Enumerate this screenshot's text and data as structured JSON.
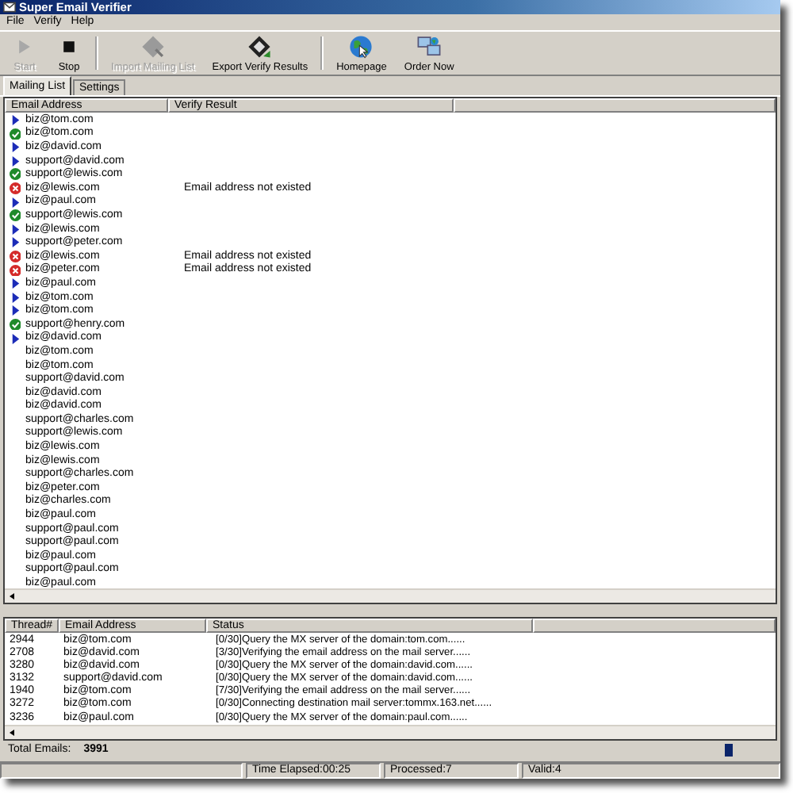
{
  "window": {
    "title": "Super Email Verifier"
  },
  "menu": [
    "File",
    "Verify",
    "Help"
  ],
  "toolbar": [
    {
      "label": "Start",
      "kind": "play",
      "disabled": true
    },
    {
      "label": "Stop",
      "kind": "stop",
      "disabled": false
    },
    {
      "label": "Import Mailing List",
      "kind": "import",
      "disabled": true
    },
    {
      "label": "Export Verify Results",
      "kind": "export",
      "disabled": false
    },
    {
      "label": "Homepage",
      "kind": "globe",
      "disabled": false
    },
    {
      "label": "Order Now",
      "kind": "order",
      "disabled": false
    }
  ],
  "tabs": [
    {
      "label": "Mailing List",
      "selected": true
    },
    {
      "label": "Settings",
      "selected": false
    }
  ],
  "mailing_list": {
    "columns": [
      "Email Address",
      "Verify Result"
    ],
    "rows": [
      {
        "email": "biz@tom.com",
        "kind": "pending"
      },
      {
        "email": "biz@tom.com",
        "kind": "valid"
      },
      {
        "email": "biz@david.com",
        "kind": "pending"
      },
      {
        "email": "support@david.com",
        "kind": "pending"
      },
      {
        "email": "support@lewis.com",
        "kind": "valid"
      },
      {
        "email": "biz@lewis.com",
        "kind": "invalid",
        "result": "Email address not existed"
      },
      {
        "email": "biz@paul.com",
        "kind": "pending"
      },
      {
        "email": "support@lewis.com",
        "kind": "valid"
      },
      {
        "email": "biz@lewis.com",
        "kind": "pending"
      },
      {
        "email": "support@peter.com",
        "kind": "pending"
      },
      {
        "email": "biz@lewis.com",
        "kind": "invalid",
        "result": "Email address not existed"
      },
      {
        "email": "biz@peter.com",
        "kind": "invalid",
        "result": "Email address not existed"
      },
      {
        "email": "biz@paul.com",
        "kind": "pending"
      },
      {
        "email": "biz@tom.com",
        "kind": "pending"
      },
      {
        "email": "biz@tom.com",
        "kind": "pending"
      },
      {
        "email": "support@henry.com",
        "kind": "valid"
      },
      {
        "email": "biz@david.com",
        "kind": "pending"
      },
      {
        "email": "biz@tom.com",
        "kind": "queued"
      },
      {
        "email": "biz@tom.com",
        "kind": "queued"
      },
      {
        "email": "support@david.com",
        "kind": "queued"
      },
      {
        "email": "biz@david.com",
        "kind": "queued"
      },
      {
        "email": "biz@david.com",
        "kind": "queued"
      },
      {
        "email": "support@charles.com",
        "kind": "queued"
      },
      {
        "email": "support@lewis.com",
        "kind": "queued"
      },
      {
        "email": "biz@lewis.com",
        "kind": "queued"
      },
      {
        "email": "biz@lewis.com",
        "kind": "queued"
      },
      {
        "email": "support@charles.com",
        "kind": "queued"
      },
      {
        "email": "biz@peter.com",
        "kind": "queued"
      },
      {
        "email": "biz@charles.com",
        "kind": "queued"
      },
      {
        "email": "biz@paul.com",
        "kind": "queued"
      },
      {
        "email": "support@paul.com",
        "kind": "queued"
      },
      {
        "email": "support@paul.com",
        "kind": "queued"
      },
      {
        "email": "biz@paul.com",
        "kind": "queued"
      },
      {
        "email": "support@paul.com",
        "kind": "queued"
      },
      {
        "email": "biz@paul.com",
        "kind": "queued"
      }
    ]
  },
  "threads": {
    "columns": [
      "Thread#",
      "Email Address",
      "Status"
    ],
    "rows": [
      {
        "thread": "2944",
        "email": "biz@tom.com",
        "status": "[0/30]Query the MX server of the domain:tom.com......"
      },
      {
        "thread": "2708",
        "email": "biz@david.com",
        "status": "[3/30]Verifying the email address on the mail server......"
      },
      {
        "thread": "3280",
        "email": "biz@david.com",
        "status": "[0/30]Query the MX server of the domain:david.com......"
      },
      {
        "thread": "3132",
        "email": "support@david.com",
        "status": "[0/30]Query the MX server of the domain:david.com......"
      },
      {
        "thread": "1940",
        "email": "biz@tom.com",
        "status": "[7/30]Verifying the email address on the mail server......"
      },
      {
        "thread": "3272",
        "email": "biz@tom.com",
        "status": "[0/30]Connecting destination mail server:tommx.163.net......"
      },
      {
        "thread": "3236",
        "email": "biz@paul.com",
        "status": "[0/30]Query the MX server of the domain:paul.com......"
      }
    ]
  },
  "totals": {
    "label": "Total Emails:",
    "value": "3991"
  },
  "status_bar": [
    "Time Elapsed:00:25",
    "Processed:7",
    "Valid:4"
  ]
}
